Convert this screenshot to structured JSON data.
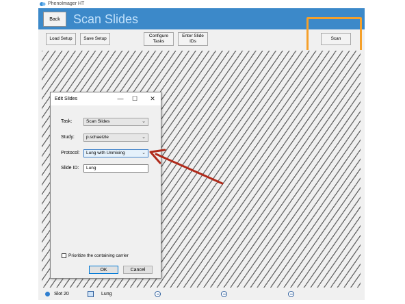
{
  "window": {
    "title": "PhenoImager HT"
  },
  "header": {
    "back_label": "Back",
    "page_title": "Scan Slides"
  },
  "toolbar": {
    "load_setup": "Load Setup",
    "save_setup": "Save Setup",
    "configure_tasks": "Configure Tasks",
    "enter_slide_ids": "Enter Slide IDs",
    "scan": "Scan"
  },
  "dialog": {
    "title": "Edit Slides",
    "min_glyph": "—",
    "max_glyph": "☐",
    "close_glyph": "✕",
    "fields": {
      "task_label": "Task:",
      "task_value": "Scan Slides",
      "study_label": "Study:",
      "study_value": "p.schaetzle",
      "protocol_label": "Protocol:",
      "protocol_value": "Lung with Unmixing",
      "slide_id_label": "Slide ID:",
      "slide_id_value": "Lung"
    },
    "prioritize_label": "Prioritize the containing carrier",
    "ok_label": "OK",
    "cancel_label": "Cancel"
  },
  "status": {
    "slot": "Slot 20",
    "slide": "Lung"
  },
  "colors": {
    "header": "#3c89c9",
    "highlight": "#f5a02a",
    "arrow": "#b02a1a"
  },
  "icons": [
    "app-icon",
    "chevron-down-icon",
    "slide-icon",
    "minus-circle-icon",
    "close-icon",
    "maximize-icon",
    "minimize-icon"
  ]
}
